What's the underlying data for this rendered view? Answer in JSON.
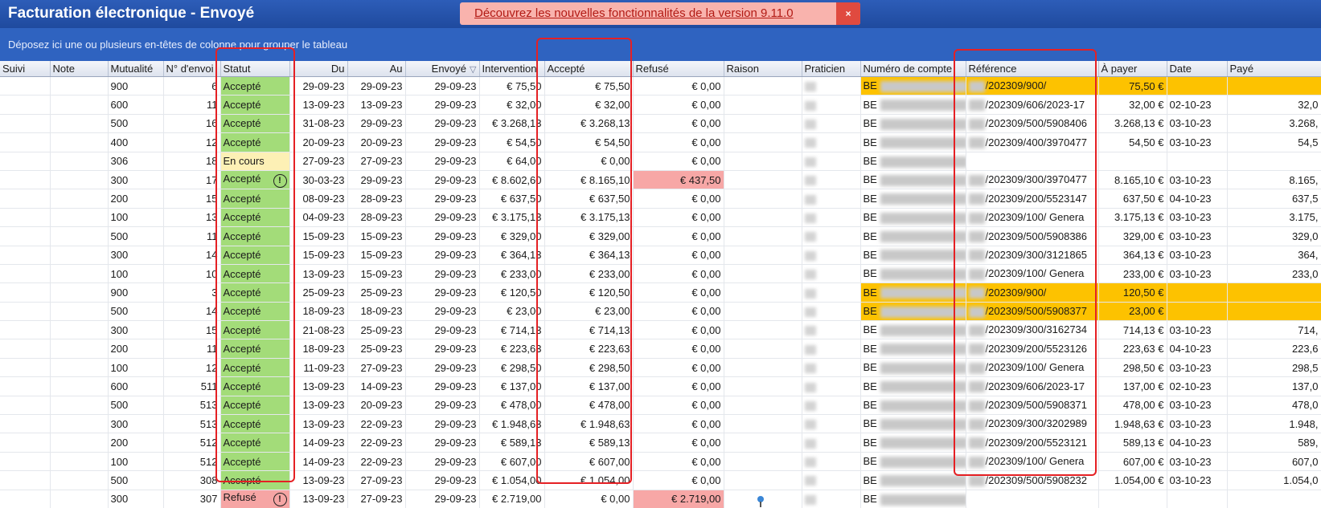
{
  "window": {
    "title": "Facturation électronique - Envoyé"
  },
  "banner": {
    "text": "Découvrez les nouvelles fonctionnalités de la version 9.11.0",
    "close": "×"
  },
  "groupbar": {
    "text": "Déposez ici une ou plusieurs en-têtes de colonne pour grouper le tableau"
  },
  "columns": [
    "Suivi",
    "Note",
    "Mutualité",
    "N° d'envoi",
    "Statut",
    "Du",
    "Au",
    "Envoyé",
    "Intervention",
    "Accepté",
    "Refusé",
    "Raison",
    "Praticien",
    "Numéro de compte",
    "Référence",
    "À payer",
    "Date",
    "Payé"
  ],
  "icons": {
    "sort": "filter-sort-icon",
    "warning": "exclamation-circle-icon",
    "note": "pin-icon"
  },
  "colors": {
    "accepte": "#a3dc79",
    "en_cours": "#fdf0b5",
    "refuse": "#f6a5a4",
    "highlight": "#fdc200",
    "titlebar": "#1f4a9e",
    "banner": "#f9b3ad"
  },
  "rows": [
    {
      "mut": "900",
      "envoi": "6",
      "statut": "Accepté",
      "du": "29-09-23",
      "au": "29-09-23",
      "envoye": "29-09-23",
      "interv": "€ 75,50",
      "accepte": "€ 75,50",
      "refuse": "€ 0,00",
      "compte": "BE",
      "ref": "/202309/900/",
      "apayer": "75,50 €",
      "date": "",
      "paye": "",
      "hl": true
    },
    {
      "mut": "600",
      "envoi": "11",
      "statut": "Accepté",
      "du": "13-09-23",
      "au": "13-09-23",
      "envoye": "29-09-23",
      "interv": "€ 32,00",
      "accepte": "€ 32,00",
      "refuse": "€ 0,00",
      "compte": "BE",
      "ref": "/202309/606/2023-17",
      "apayer": "32,00 €",
      "date": "02-10-23",
      "paye": "32,0"
    },
    {
      "mut": "500",
      "envoi": "16",
      "statut": "Accepté",
      "du": "31-08-23",
      "au": "29-09-23",
      "envoye": "29-09-23",
      "interv": "€ 3.268,13",
      "accepte": "€ 3.268,13",
      "refuse": "€ 0,00",
      "compte": "BE",
      "ref": "/202309/500/5908406",
      "apayer": "3.268,13 €",
      "date": "03-10-23",
      "paye": "3.268,"
    },
    {
      "mut": "400",
      "envoi": "12",
      "statut": "Accepté",
      "du": "20-09-23",
      "au": "20-09-23",
      "envoye": "29-09-23",
      "interv": "€ 54,50",
      "accepte": "€ 54,50",
      "refuse": "€ 0,00",
      "compte": "BE",
      "ref": "/202309/400/3970477",
      "apayer": "54,50 €",
      "date": "03-10-23",
      "paye": "54,5"
    },
    {
      "mut": "306",
      "envoi": "18",
      "statut": "En cours",
      "du": "27-09-23",
      "au": "27-09-23",
      "envoye": "29-09-23",
      "interv": "€ 64,00",
      "accepte": "€ 0,00",
      "refuse": "€ 0,00",
      "compte": "BE",
      "ref": "",
      "apayer": "",
      "date": "",
      "paye": ""
    },
    {
      "mut": "300",
      "envoi": "17",
      "statut": "Accepté",
      "warn": true,
      "du": "30-03-23",
      "au": "29-09-23",
      "envoye": "29-09-23",
      "interv": "€ 8.602,60",
      "accepte": "€ 8.165,10",
      "refuse": "€ 437,50",
      "refuseHl": true,
      "compte": "BE",
      "ref": "/202309/300/3970477",
      "apayer": "8.165,10 €",
      "date": "03-10-23",
      "paye": "8.165,"
    },
    {
      "mut": "200",
      "envoi": "15",
      "statut": "Accepté",
      "du": "08-09-23",
      "au": "28-09-23",
      "envoye": "29-09-23",
      "interv": "€ 637,50",
      "accepte": "€ 637,50",
      "refuse": "€ 0,00",
      "compte": "BE",
      "ref": "/202309/200/5523147",
      "apayer": "637,50 €",
      "date": "04-10-23",
      "paye": "637,5"
    },
    {
      "mut": "100",
      "envoi": "13",
      "statut": "Accepté",
      "du": "04-09-23",
      "au": "28-09-23",
      "envoye": "29-09-23",
      "interv": "€ 3.175,13",
      "accepte": "€ 3.175,13",
      "refuse": "€ 0,00",
      "compte": "BE",
      "ref": "/202309/100/ Genera",
      "apayer": "3.175,13 €",
      "date": "03-10-23",
      "paye": "3.175,"
    },
    {
      "mut": "500",
      "envoi": "11",
      "statut": "Accepté",
      "du": "15-09-23",
      "au": "15-09-23",
      "envoye": "29-09-23",
      "interv": "€ 329,00",
      "accepte": "€ 329,00",
      "refuse": "€ 0,00",
      "compte": "BE",
      "ref": "/202309/500/5908386",
      "apayer": "329,00 €",
      "date": "03-10-23",
      "paye": "329,0"
    },
    {
      "mut": "300",
      "envoi": "14",
      "statut": "Accepté",
      "du": "15-09-23",
      "au": "15-09-23",
      "envoye": "29-09-23",
      "interv": "€ 364,13",
      "accepte": "€ 364,13",
      "refuse": "€ 0,00",
      "compte": "BE",
      "ref": "/202309/300/3121865",
      "apayer": "364,13 €",
      "date": "03-10-23",
      "paye": "364,"
    },
    {
      "mut": "100",
      "envoi": "10",
      "statut": "Accepté",
      "du": "13-09-23",
      "au": "15-09-23",
      "envoye": "29-09-23",
      "interv": "€ 233,00",
      "accepte": "€ 233,00",
      "refuse": "€ 0,00",
      "compte": "BE",
      "ref": "/202309/100/ Genera",
      "apayer": "233,00 €",
      "date": "03-10-23",
      "paye": "233,0"
    },
    {
      "mut": "900",
      "envoi": "3",
      "statut": "Accepté",
      "du": "25-09-23",
      "au": "25-09-23",
      "envoye": "29-09-23",
      "interv": "€ 120,50",
      "accepte": "€ 120,50",
      "refuse": "€ 0,00",
      "compte": "BE",
      "ref": "/202309/900/",
      "apayer": "120,50 €",
      "date": "",
      "paye": "",
      "hl": true
    },
    {
      "mut": "500",
      "envoi": "14",
      "statut": "Accepté",
      "du": "18-09-23",
      "au": "18-09-23",
      "envoye": "29-09-23",
      "interv": "€ 23,00",
      "accepte": "€ 23,00",
      "refuse": "€ 0,00",
      "compte": "BE",
      "ref": "/202309/500/5908377",
      "apayer": "23,00 €",
      "date": "",
      "paye": "",
      "hl": true
    },
    {
      "mut": "300",
      "envoi": "15",
      "statut": "Accepté",
      "du": "21-08-23",
      "au": "25-09-23",
      "envoye": "29-09-23",
      "interv": "€ 714,13",
      "accepte": "€ 714,13",
      "refuse": "€ 0,00",
      "compte": "BE",
      "ref": "/202309/300/3162734",
      "apayer": "714,13 €",
      "date": "03-10-23",
      "paye": "714,"
    },
    {
      "mut": "200",
      "envoi": "11",
      "statut": "Accepté",
      "du": "18-09-23",
      "au": "25-09-23",
      "envoye": "29-09-23",
      "interv": "€ 223,63",
      "accepte": "€ 223,63",
      "refuse": "€ 0,00",
      "compte": "BE",
      "ref": "/202309/200/5523126",
      "apayer": "223,63 €",
      "date": "04-10-23",
      "paye": "223,6"
    },
    {
      "mut": "100",
      "envoi": "12",
      "statut": "Accepté",
      "du": "11-09-23",
      "au": "27-09-23",
      "envoye": "29-09-23",
      "interv": "€ 298,50",
      "accepte": "€ 298,50",
      "refuse": "€ 0,00",
      "compte": "BE",
      "ref": "/202309/100/ Genera",
      "apayer": "298,50 €",
      "date": "03-10-23",
      "paye": "298,5"
    },
    {
      "mut": "600",
      "envoi": "511",
      "statut": "Accepté",
      "du": "13-09-23",
      "au": "14-09-23",
      "envoye": "29-09-23",
      "interv": "€ 137,00",
      "accepte": "€ 137,00",
      "refuse": "€ 0,00",
      "compte": "BE",
      "ref": "/202309/606/2023-17",
      "apayer": "137,00 €",
      "date": "02-10-23",
      "paye": "137,0"
    },
    {
      "mut": "500",
      "envoi": "513",
      "statut": "Accepté",
      "du": "13-09-23",
      "au": "20-09-23",
      "envoye": "29-09-23",
      "interv": "€ 478,00",
      "accepte": "€ 478,00",
      "refuse": "€ 0,00",
      "compte": "BE",
      "ref": "/202309/500/5908371",
      "apayer": "478,00 €",
      "date": "03-10-23",
      "paye": "478,0"
    },
    {
      "mut": "300",
      "envoi": "513",
      "statut": "Accepté",
      "du": "13-09-23",
      "au": "22-09-23",
      "envoye": "29-09-23",
      "interv": "€ 1.948,63",
      "accepte": "€ 1.948,63",
      "refuse": "€ 0,00",
      "compte": "BE",
      "ref": "/202309/300/3202989",
      "apayer": "1.948,63 €",
      "date": "03-10-23",
      "paye": "1.948,"
    },
    {
      "mut": "200",
      "envoi": "512",
      "statut": "Accepté",
      "du": "14-09-23",
      "au": "22-09-23",
      "envoye": "29-09-23",
      "interv": "€ 589,13",
      "accepte": "€ 589,13",
      "refuse": "€ 0,00",
      "compte": "BE",
      "ref": "/202309/200/5523121",
      "apayer": "589,13 €",
      "date": "04-10-23",
      "paye": "589,"
    },
    {
      "mut": "100",
      "envoi": "512",
      "statut": "Accepté",
      "du": "14-09-23",
      "au": "22-09-23",
      "envoye": "29-09-23",
      "interv": "€ 607,00",
      "accepte": "€ 607,00",
      "refuse": "€ 0,00",
      "compte": "BE",
      "ref": "/202309/100/ Genera",
      "apayer": "607,00 €",
      "date": "03-10-23",
      "paye": "607,0"
    },
    {
      "mut": "500",
      "envoi": "308",
      "statut": "Accepté",
      "du": "13-09-23",
      "au": "27-09-23",
      "envoye": "29-09-23",
      "interv": "€ 1.054,00",
      "accepte": "€ 1.054,00",
      "refuse": "€ 0,00",
      "compte": "BE",
      "ref": "/202309/500/5908232",
      "apayer": "1.054,00 €",
      "date": "03-10-23",
      "paye": "1.054,0"
    },
    {
      "mut": "300",
      "envoi": "307",
      "statut": "Refusé",
      "warn": true,
      "du": "13-09-23",
      "au": "27-09-23",
      "envoye": "29-09-23",
      "interv": "€ 2.719,00",
      "accepte": "€ 0,00",
      "refuse": "€ 2.719,00",
      "refuseHl": true,
      "pin": true,
      "compte": "BE",
      "ref": "",
      "apayer": "",
      "date": "",
      "paye": ""
    }
  ]
}
